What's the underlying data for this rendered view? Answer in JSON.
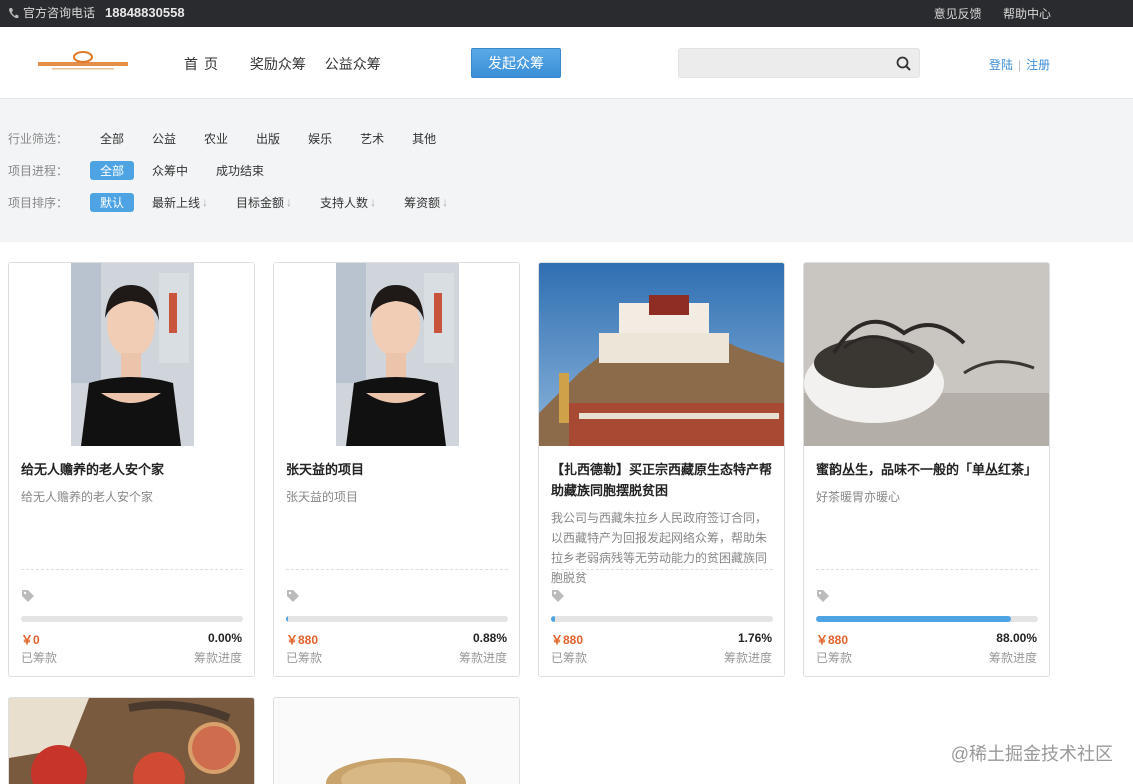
{
  "topbar": {
    "phone_label": "官方咨询电话",
    "phone_number": "18848830558",
    "feedback": "意见反馈",
    "help": "帮助中心"
  },
  "header": {
    "nav": [
      "首页",
      "奖励众筹",
      "公益众筹"
    ],
    "launch_label": "发起众筹",
    "search_placeholder": "",
    "login": "登陆",
    "register": "注册"
  },
  "filters": {
    "industry_label": "行业筛选：",
    "industries": [
      "全部",
      "公益",
      "农业",
      "出版",
      "娱乐",
      "艺术",
      "其他"
    ],
    "progress_label": "项目进程：",
    "progress": [
      "全部",
      "众筹中",
      "成功结束"
    ],
    "sort_label": "项目排序：",
    "sort": [
      "默认",
      "最新上线",
      "目标金额",
      "支持人数",
      "筹资额"
    ]
  },
  "cards": [
    {
      "title": "给无人赡养的老人安个家",
      "desc": "给无人赡养的老人安个家",
      "amount": "￥0",
      "percent": "0.00%",
      "progress": 0.0,
      "amount_label": "已筹款",
      "percent_label": "筹款进度"
    },
    {
      "title": "张天益的项目",
      "desc": "张天益的项目",
      "amount": "￥880",
      "percent": "0.88%",
      "progress": 0.88,
      "amount_label": "已筹款",
      "percent_label": "筹款进度"
    },
    {
      "title": "【扎西德勒】买正宗西藏原生态特产帮助藏族同胞摆脱贫困",
      "desc": "我公司与西藏朱拉乡人民政府签订合同，以西藏特产为回报发起网络众筹，帮助朱拉乡老弱病残等无劳动能力的贫困藏族同胞脱贫",
      "amount": "￥880",
      "percent": "1.76%",
      "progress": 1.76,
      "amount_label": "已筹款",
      "percent_label": "筹款进度"
    },
    {
      "title": "蜜韵丛生，品味不一般的「单丛红茶」",
      "desc": "好茶暖胃亦暖心",
      "amount": "￥880",
      "percent": "88.00%",
      "progress": 88.0,
      "amount_label": "已筹款",
      "percent_label": "筹款进度"
    }
  ],
  "watermark": "@稀土掘金技术社区",
  "colors": {
    "accent": "#4ea3e4",
    "amount": "#e0622a",
    "topbar": "#2a2b2e"
  }
}
